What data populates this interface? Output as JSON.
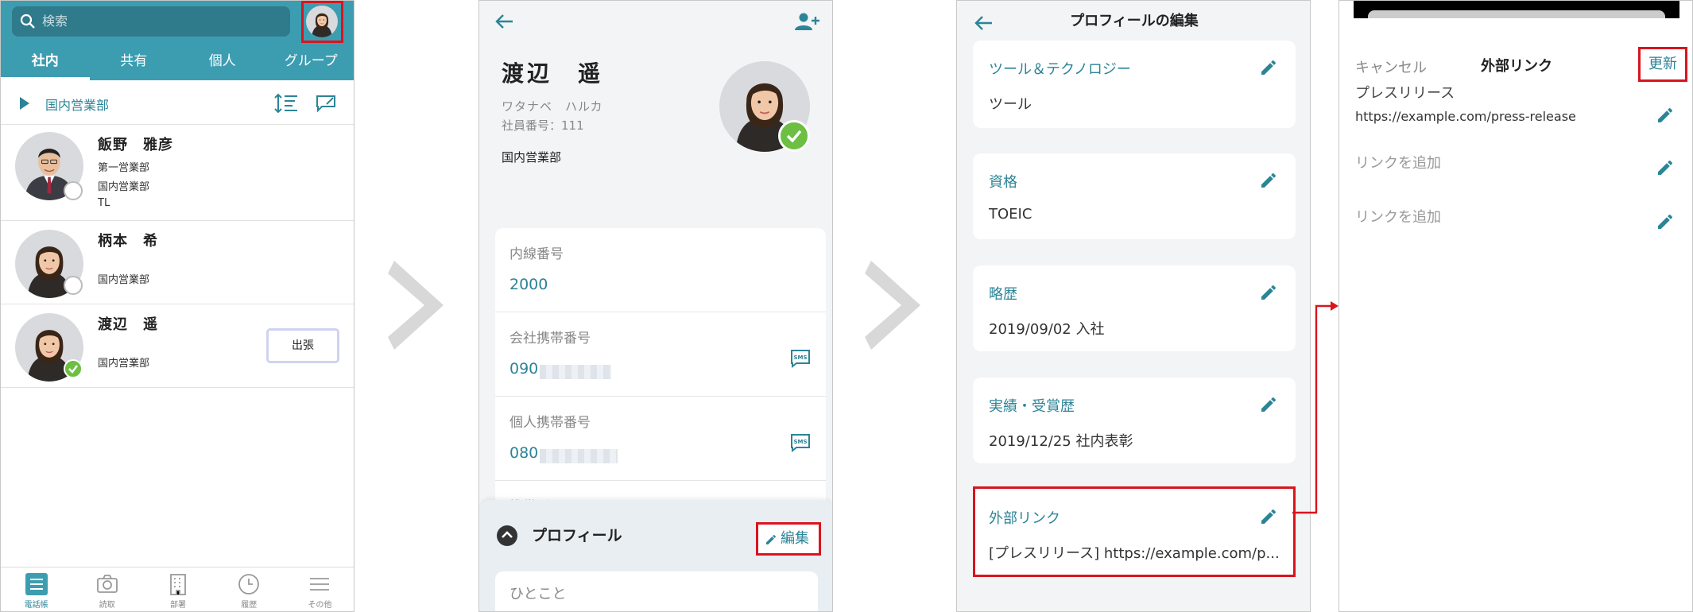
{
  "panel1": {
    "search_placeholder": "検索",
    "tabs": [
      "社内",
      "共有",
      "個人",
      "グループ"
    ],
    "dept_label": "国内営業部",
    "persons": [
      {
        "name": "飯野　雅彦",
        "lines": [
          "第一営業部",
          "国内営業部",
          "TL"
        ],
        "status": "off"
      },
      {
        "name": "柄本　希",
        "lines": [
          "国内営業部"
        ],
        "status": "off"
      },
      {
        "name": "渡辺　遥",
        "lines": [
          "国内営業部"
        ],
        "status": "on",
        "button": "出張"
      }
    ],
    "nav": [
      "電話帳",
      "読取",
      "部署",
      "履歴",
      "その他"
    ]
  },
  "panel2": {
    "name": "渡辺　遥",
    "kana": "ワタナベ　ハルカ",
    "emp_no": "社員番号：111",
    "dept": "国内営業部",
    "fields": [
      {
        "label": "内線番号",
        "value": "2000"
      },
      {
        "label": "会社携帯番号",
        "value": "090"
      },
      {
        "label": "個人携帯番号",
        "value": "080"
      },
      {
        "label": "携帯番号",
        "value": ""
      }
    ],
    "sheet_title": "プロフィール",
    "edit_label": "編集",
    "hitokoto": "ひとこと"
  },
  "panel3": {
    "title": "プロフィールの編集",
    "cards": [
      {
        "label": "ツール＆テクノロジー",
        "value": "ツール"
      },
      {
        "label": "資格",
        "value": "TOEIC"
      },
      {
        "label": "略歴",
        "value": "2019/09/02 入社"
      },
      {
        "label": "実績・受賞歴",
        "value": "2019/12/25 社内表彰"
      },
      {
        "label": "外部リンク",
        "value": "[プレスリリース] https://example.com/p..."
      }
    ]
  },
  "panel4": {
    "cancel": "キャンセル",
    "title": "外部リンク",
    "update": "更新",
    "links": [
      {
        "label": "プレスリリース",
        "url": "https://example.com/press-release"
      },
      {
        "placeholder": "リンクを追加"
      },
      {
        "placeholder": "リンクを追加"
      }
    ]
  },
  "colors": {
    "teal": "#3c9db1",
    "accent": "#2c8497",
    "highlight": "#d9141e",
    "online": "#6cbf43"
  }
}
